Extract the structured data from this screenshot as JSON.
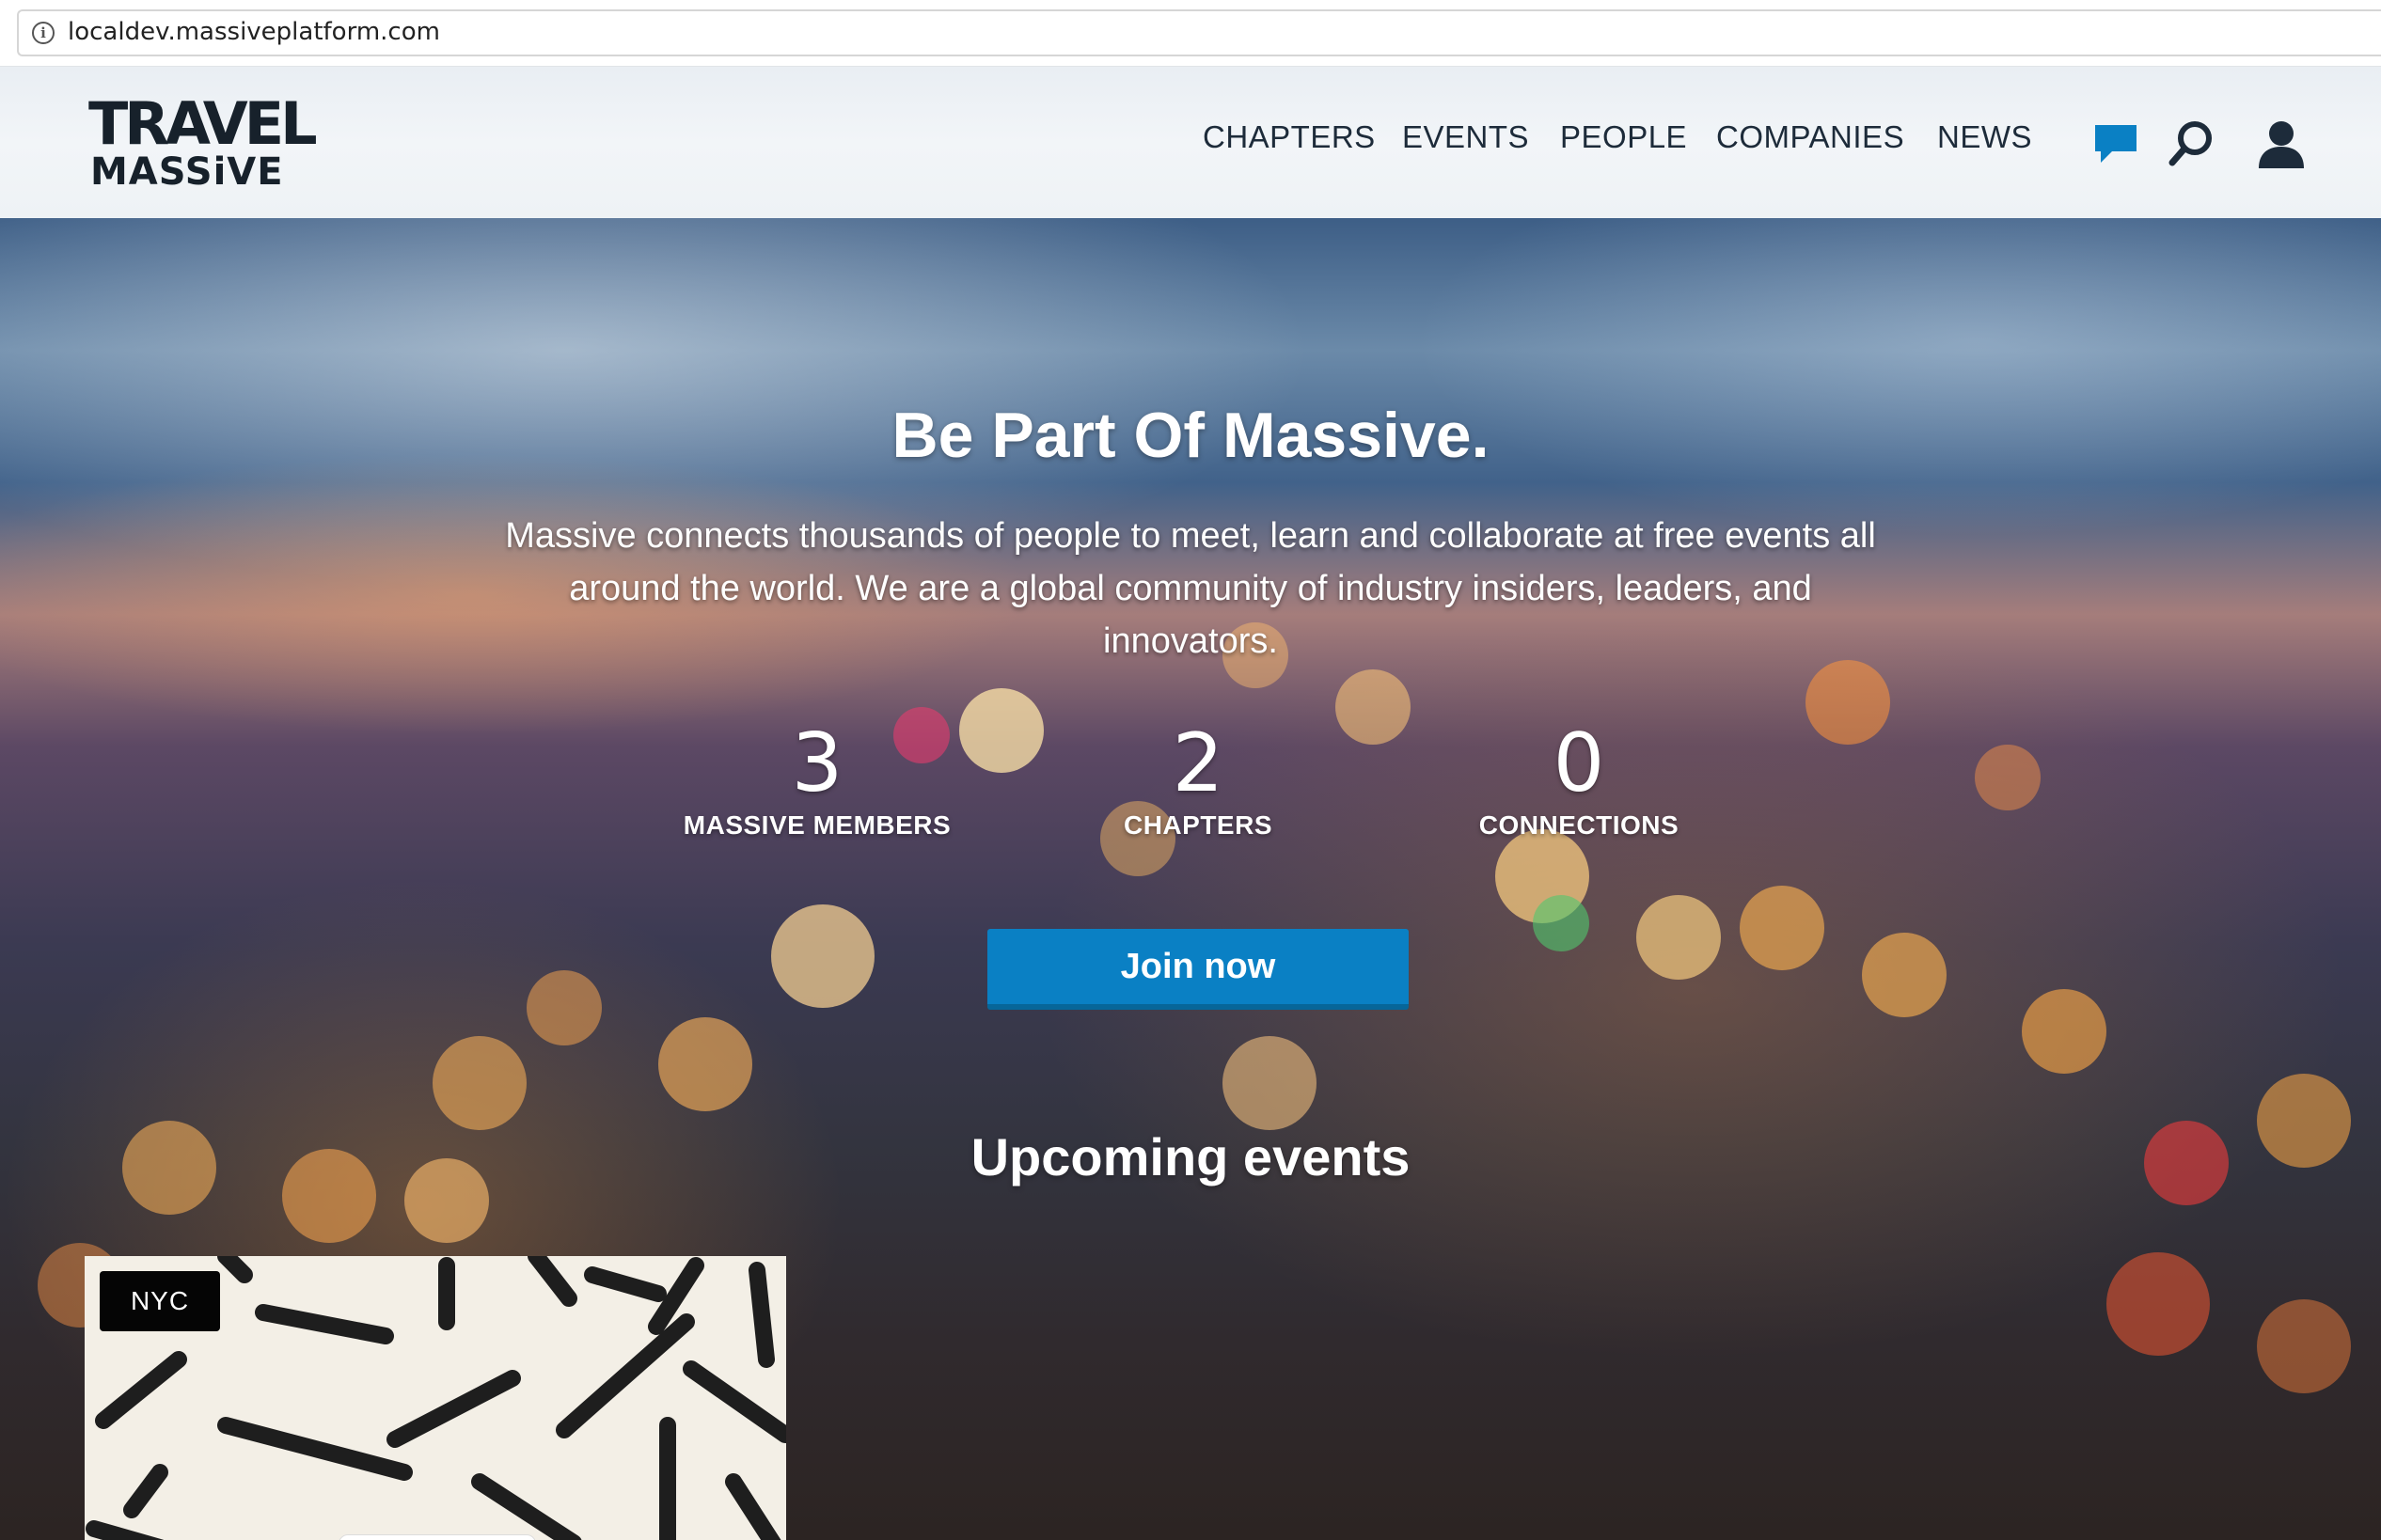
{
  "browser": {
    "url": "localdev.massiveplatform.com"
  },
  "header": {
    "logo_line1": "TRAVEL",
    "logo_line2": "MASSiVE",
    "nav": [
      {
        "label": "CHAPTERS"
      },
      {
        "label": "EVENTS"
      },
      {
        "label": "PEOPLE"
      },
      {
        "label": "COMPANIES"
      },
      {
        "label": "NEWS"
      }
    ],
    "icons": [
      "chat-icon",
      "search-icon",
      "user-icon"
    ],
    "chat_icon_color": "#0a80c4"
  },
  "hero": {
    "title": "Be Part Of Massive.",
    "description": "Massive connects thousands of people to meet, learn and collaborate at free events all around the world. We are a global community of industry insiders, leaders, and innovators.",
    "stats": [
      {
        "value": "3",
        "label": "MASSIVE MEMBERS"
      },
      {
        "value": "2",
        "label": "CHAPTERS"
      },
      {
        "value": "0",
        "label": "CONNECTIONS"
      }
    ],
    "cta_label": "Join now",
    "cta_color": "#0a80c4"
  },
  "events": {
    "section_title": "Upcoming events",
    "cards": [
      {
        "chapter": "NYC"
      }
    ]
  }
}
